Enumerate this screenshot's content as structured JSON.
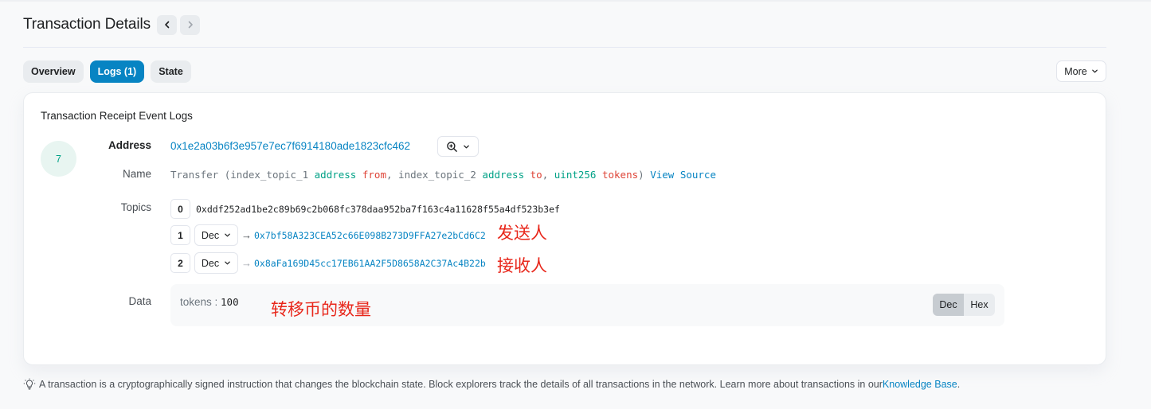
{
  "header": {
    "title": "Transaction Details"
  },
  "tabs": [
    {
      "label": "Overview",
      "active": false
    },
    {
      "label": "Logs (1)",
      "active": true
    },
    {
      "label": "State",
      "active": false
    }
  ],
  "more_label": "More",
  "card": {
    "title": "Transaction Receipt Event Logs",
    "log_index": "7",
    "address": {
      "label": "Address",
      "value": "0x1e2a03b6f3e957e7ec7f6914180ade1823cfc462"
    },
    "name": {
      "label": "Name",
      "event": "Transfer",
      "open": " (",
      "p1_kw": "index_topic_1",
      "p1_type": "address",
      "p1_name": "from",
      "sep1": ", ",
      "p2_kw": "index_topic_2",
      "p2_type": "address",
      "p2_name": "to",
      "sep2": ", ",
      "p3_type": "uint256",
      "p3_name": "tokens",
      "close": ")",
      "view_source": "View Source"
    },
    "topics": {
      "label": "Topics",
      "rows": [
        {
          "index": "0",
          "value": "0xddf252ad1be2c89b69c2b068fc378daa952ba7f163c4a11628f55a4df523b3ef"
        },
        {
          "index": "1",
          "format": "Dec",
          "arrow": "→",
          "value": "0x7bf58A323CEA52c66E098B273D9FFA27e2bCd6C2",
          "annotation": "发送人"
        },
        {
          "index": "2",
          "format": "Dec",
          "arrow": "→",
          "value": "0x8aFa169D45cc17EB61AA2F5D8658A2C37Ac4B22b",
          "annotation": "接收人"
        }
      ]
    },
    "data": {
      "label": "Data",
      "key": "tokens : ",
      "value": "100",
      "annotation": "转移币的数量",
      "toggle": [
        "Dec",
        "Hex"
      ],
      "toggle_active": "Dec"
    }
  },
  "footer": {
    "text": "A transaction is a cryptographically signed instruction that changes the blockchain state. Block explorers track the details of all transactions in the network. Learn more about transactions in our ",
    "link": "Knowledge Base",
    "end": "."
  },
  "colors": {
    "accent": "#0784c3",
    "green": "#00a186",
    "red": "#de4437",
    "annotation": "#e8271b"
  },
  "icons": [
    "chevron-left-icon",
    "chevron-right-icon",
    "chevron-down-icon",
    "zoom-in-icon",
    "lightbulb-icon"
  ]
}
